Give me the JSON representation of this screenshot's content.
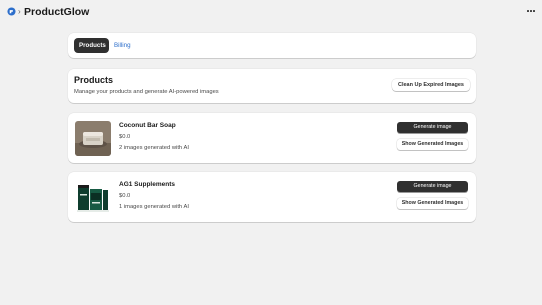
{
  "app": {
    "title": "ProductGlow",
    "logo_icon": "app-logo-icon",
    "more_icon": "more-horizontal-icon"
  },
  "nav": {
    "tabs": [
      {
        "label": "Products",
        "active": true
      },
      {
        "label": "Billing",
        "active": false
      }
    ]
  },
  "page": {
    "title": "Products",
    "subtitle": "Manage your products and generate AI-powered images",
    "cleanup_label": "Clean Up Expired Images"
  },
  "products": [
    {
      "name": "Coconut Bar Soap",
      "price": "$0.0",
      "generated": "2 images generated with AI",
      "generate_label": "Generate image",
      "show_label": "Show Generated Images"
    },
    {
      "name": "AG1 Supplements",
      "price": "$0.0",
      "generated": "1 images generated with AI",
      "generate_label": "Generate image",
      "show_label": "Show Generated Images"
    }
  ],
  "colors": {
    "background": "#f1f1f1",
    "primary_button": "#303030",
    "link": "#2c6ecb",
    "logo": "#2c6ecb"
  }
}
